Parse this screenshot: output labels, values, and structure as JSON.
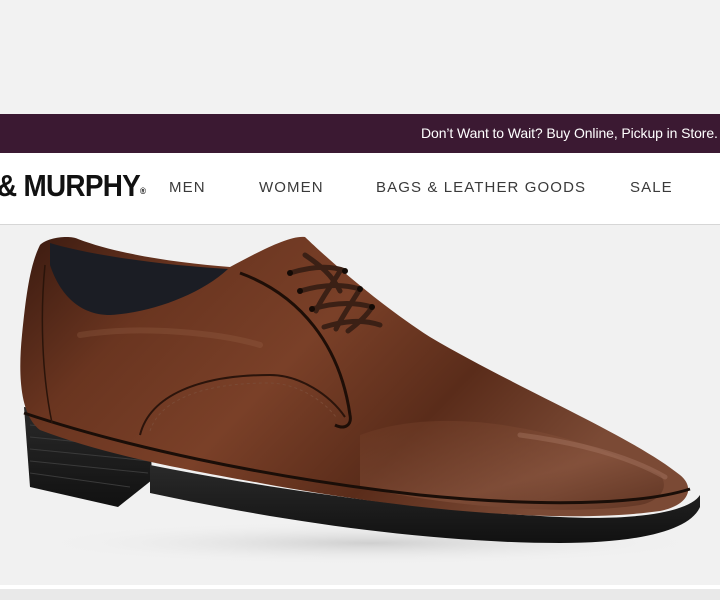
{
  "promo": {
    "text": "Don’t Want to Wait? Buy Online, Pickup in Store."
  },
  "header": {
    "logo_text": "& MURPHY",
    "logo_mark": "®"
  },
  "nav": {
    "items": [
      {
        "label": "MEN"
      },
      {
        "label": "WOMEN"
      },
      {
        "label": "BAGS & LEATHER GOODS"
      },
      {
        "label": "SALE"
      }
    ]
  },
  "hero": {
    "image": "brown-leather-derby-shoe",
    "colors": {
      "promo_bg": "#3b1932",
      "leather": "#5a2e1c",
      "sole": "#1c1c1c"
    }
  }
}
